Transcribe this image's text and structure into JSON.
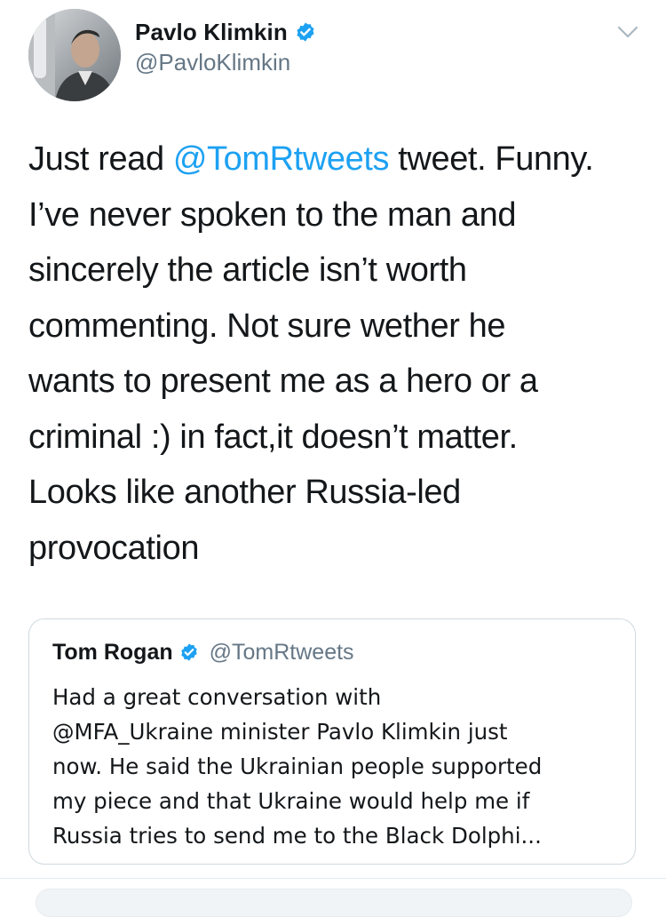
{
  "author": {
    "name": "Pavlo Klimkin",
    "handle": "@PavloKlimkin",
    "verified": true
  },
  "tweet": {
    "lines": [
      {
        "before": "Just read ",
        "mention": "@TomRtweets",
        "after": " tweet. Funny."
      },
      {
        "text": "I’ve never spoken to the man and"
      },
      {
        "text": "sincerely the article isn’t worth"
      },
      {
        "text": "commenting. Not sure wether he"
      },
      {
        "text": "wants to present me as a hero or a"
      },
      {
        "text": "criminal :) in fact,it doesn’t matter."
      },
      {
        "text": "Looks like another Russia-led"
      },
      {
        "text": "provocation"
      }
    ]
  },
  "quoted_tweet": {
    "name": "Tom Rogan",
    "handle": "@TomRtweets",
    "verified": true,
    "lines": [
      "Had a great conversation with",
      "@MFA_Ukraine minister Pavlo Klimkin just",
      "now. He said the Ukrainian people supported",
      "my piece and that Ukraine would help me if",
      "Russia tries to send me to the Black Dolphi..."
    ]
  },
  "icons": {
    "verified": "verified-badge-icon",
    "menu": "chevron-down-icon"
  },
  "colors": {
    "link": "#1da1f2",
    "text": "#14171a",
    "secondary": "#657786",
    "border": "#cfd9de"
  }
}
